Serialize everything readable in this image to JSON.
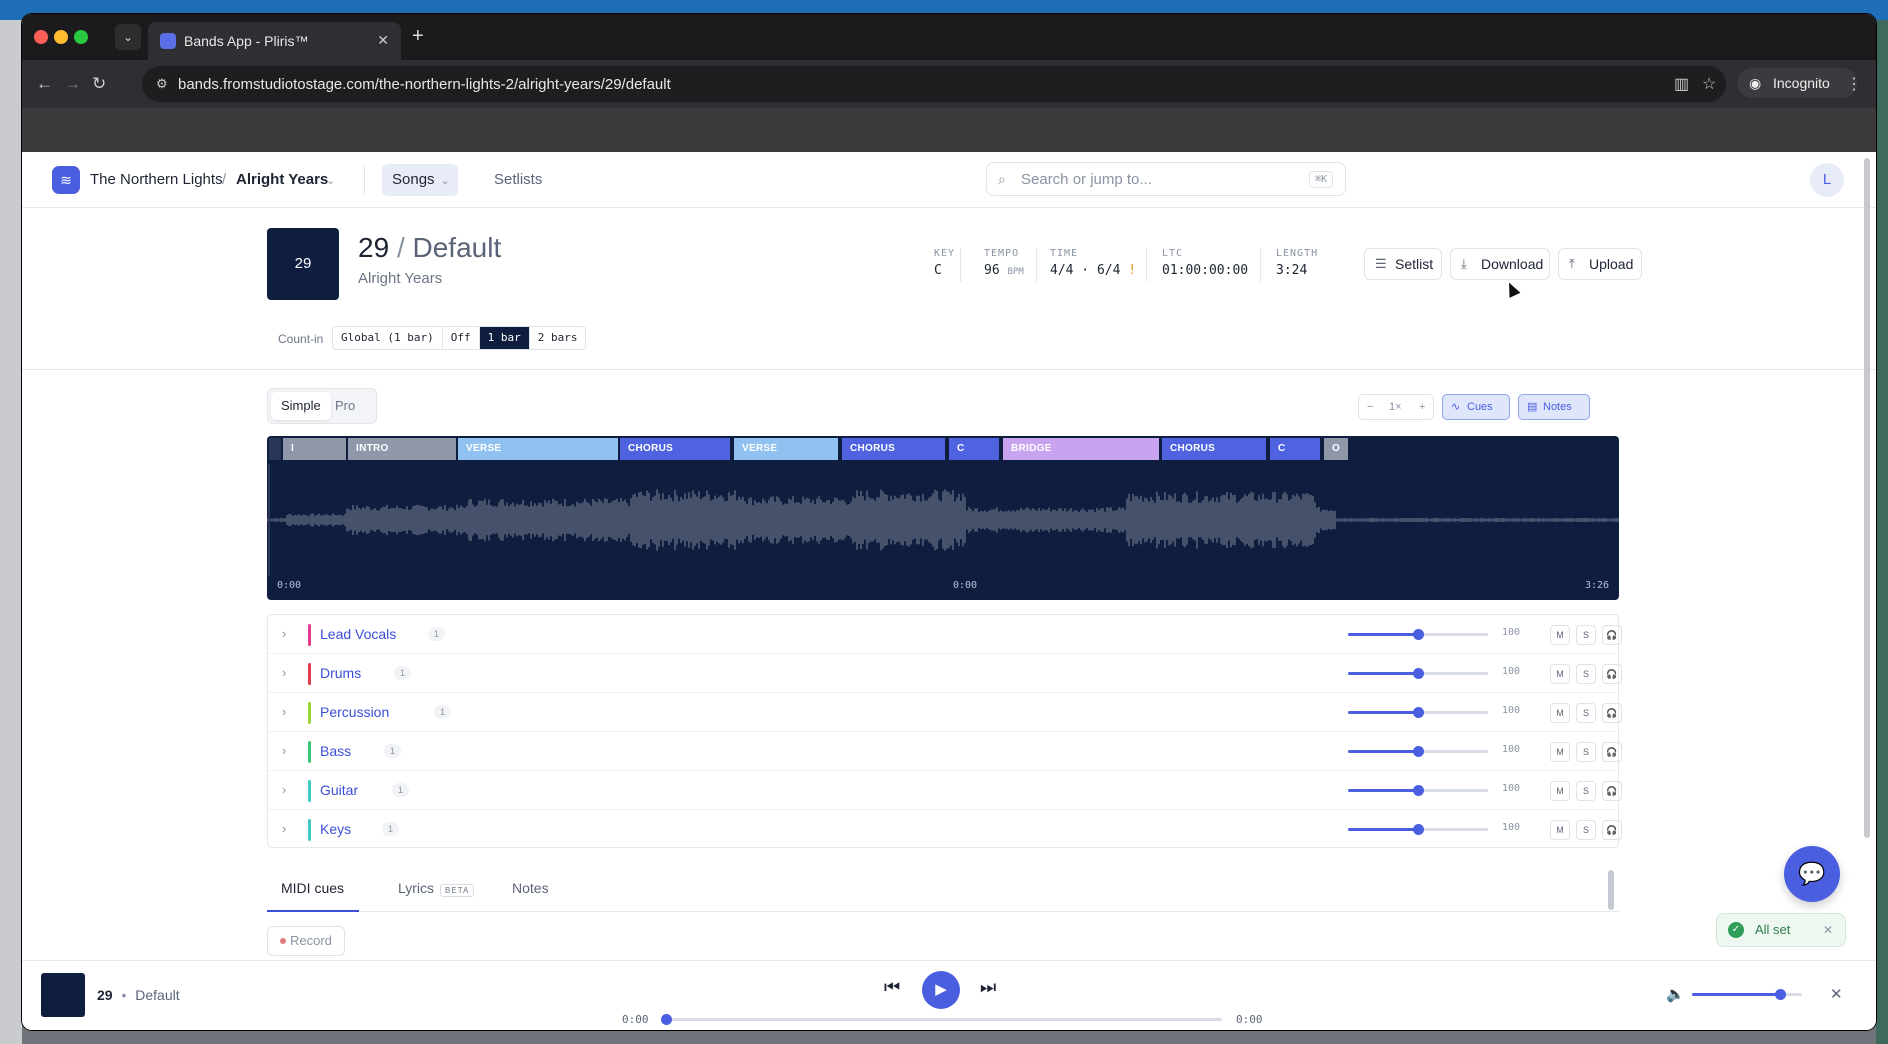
{
  "browser": {
    "tab_title": "Bands App - Pliris™",
    "url": "bands.fromstudiotostage.com/the-northern-lights-2/alright-years/29/default",
    "incognito_label": "Incognito"
  },
  "header": {
    "band": "The Northern Lights",
    "separator": "/",
    "album": "Alright Years",
    "nav_songs": "Songs",
    "nav_setlists": "Setlists",
    "search_placeholder": "Search or jump to...",
    "search_shortcut": "⌘K",
    "avatar_initial": "L"
  },
  "song": {
    "art_label": "29",
    "number": "29",
    "slash": "/",
    "version": "Default",
    "album": "Alright Years",
    "meta": {
      "key_label": "KEY",
      "key": "C",
      "tempo_label": "TEMPO",
      "tempo": "96",
      "tempo_unit": "BPM",
      "time_label": "TIME",
      "time": "4/4 · 6/4",
      "time_warn": "!",
      "ltc_label": "LTC",
      "ltc": "01:00:00:00",
      "length_label": "LENGTH",
      "length": "3:24"
    },
    "buttons": {
      "setlist": "Setlist",
      "download": "Download",
      "upload": "Upload"
    },
    "countin_label": "Count-in",
    "countin_options": [
      "Global (1 bar)",
      "Off",
      "1 bar",
      "2 bars"
    ],
    "countin_selected": "1 bar"
  },
  "view": {
    "modes": [
      "Simple",
      "Pro"
    ],
    "active_mode": "Simple",
    "zoom_minus": "−",
    "zoom_level": "1×",
    "zoom_plus": "+",
    "cues_label": "Cues",
    "notes_label": "Notes"
  },
  "waveform": {
    "sections": [
      {
        "label": "I",
        "color": "#8f97a8"
      },
      {
        "label": "INTRO",
        "color": "#8f97a8"
      },
      {
        "label": "VERSE",
        "color": "#8fc2f0"
      },
      {
        "label": "CHORUS",
        "color": "#4f63e0"
      },
      {
        "label": "VERSE",
        "color": "#8fc2f0"
      },
      {
        "label": "CHORUS",
        "color": "#4f63e0"
      },
      {
        "label": "C",
        "color": "#4f63e0"
      },
      {
        "label": "BRIDGE",
        "color": "#c8a3f0"
      },
      {
        "label": "CHORUS",
        "color": "#4f63e0"
      },
      {
        "label": "C",
        "color": "#4f63e0"
      },
      {
        "label": "O",
        "color": "#8f97a8"
      }
    ],
    "time_start": "0:00",
    "time_mid": "0:00",
    "time_end": "3:26"
  },
  "tracks": [
    {
      "name": "Lead Vocals",
      "count": "1",
      "color": "#e23c8f",
      "volume": "100",
      "level": 0.5
    },
    {
      "name": "Drums",
      "count": "1",
      "color": "#e23b4e",
      "volume": "100",
      "level": 0.5
    },
    {
      "name": "Percussion",
      "count": "1",
      "color": "#9ad33a",
      "volume": "100",
      "level": 0.5
    },
    {
      "name": "Bass",
      "count": "1",
      "color": "#38c77a",
      "volume": "100",
      "level": 0.5
    },
    {
      "name": "Guitar",
      "count": "1",
      "color": "#3fc8c4",
      "volume": "100",
      "level": 0.5
    },
    {
      "name": "Keys",
      "count": "1",
      "color": "#3fc8c4",
      "volume": "100",
      "level": 0.5
    }
  ],
  "track_buttons": {
    "mute": "M",
    "solo": "S"
  },
  "bottom_tabs": {
    "midi": "MIDI cues",
    "lyrics": "Lyrics",
    "beta": "BETA",
    "notes": "Notes",
    "record": "Record"
  },
  "toast": {
    "text": "All set"
  },
  "player": {
    "number": "29",
    "dot": "•",
    "version": "Default",
    "time_current": "0:00",
    "time_total": "0:00",
    "progress": 0,
    "volume_level": 0.8
  }
}
